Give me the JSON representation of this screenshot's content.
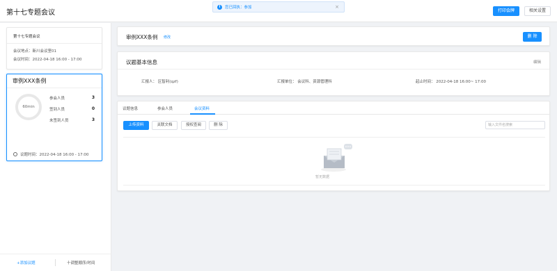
{
  "header": {
    "title": "第十七专题会议",
    "toast": {
      "text": "您已回执：参加"
    },
    "print_button": "打印会牌",
    "settings_button": "相关设置"
  },
  "meeting_card": {
    "title": "第十七专题会议",
    "location": "会议地点：新川会议室01",
    "time": "会议时间：2022-04-18 16:00 - 17:00"
  },
  "topic_card": {
    "title": "审例XXX条例",
    "duration": "60min",
    "stats": [
      {
        "label": "参会人员",
        "value": "3"
      },
      {
        "label": "签到人员",
        "value": "0"
      },
      {
        "label": "未签到人员",
        "value": "3"
      }
    ],
    "time": "议题时间：2022-04-18 16:00 - 17:00"
  },
  "sidebar_footer": {
    "add": "+添加议题",
    "adjust": "十调整顺序/时间"
  },
  "topic_header": {
    "title": "审例XXX条例",
    "edit": "修改",
    "delete": "删 除"
  },
  "basic_info": {
    "title": "议题基本信息",
    "edit": "编辑",
    "reporter": "汇报人：  区智利(qzf)",
    "unit": "汇报单位：  会议科、资源管理科",
    "time": "起止时间：  2022-04-18 16:00~ 17:00"
  },
  "tabs": [
    "议题信息",
    "参会人员",
    "会议资料"
  ],
  "toolbar": {
    "upload": "上传资料",
    "link": "关联文档",
    "permission": "授权查阅",
    "delete": "删 除",
    "search_placeholder": "输入文件名搜索"
  },
  "empty": "暂无数据",
  "colors": {
    "accent": "#1890ff"
  }
}
